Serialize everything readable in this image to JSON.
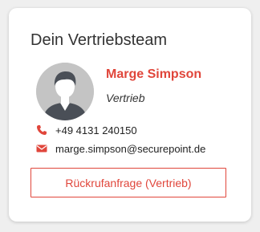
{
  "card": {
    "title": "Dein Vertriebsteam",
    "contact": {
      "avatar_icon": "person-avatar-icon",
      "name": "Marge Simpson",
      "role": "Vertrieb",
      "phone": "+49 4131 240150",
      "phone_icon": "phone-icon",
      "email": "marge.simpson@securepoint.de",
      "email_icon": "envelope-icon"
    },
    "callback_button_label": "Rückrufanfrage (Vertrieb)"
  },
  "colors": {
    "accent": "#e0463b",
    "text": "#333333",
    "card_background": "#ffffff",
    "page_background": "#efefef"
  }
}
